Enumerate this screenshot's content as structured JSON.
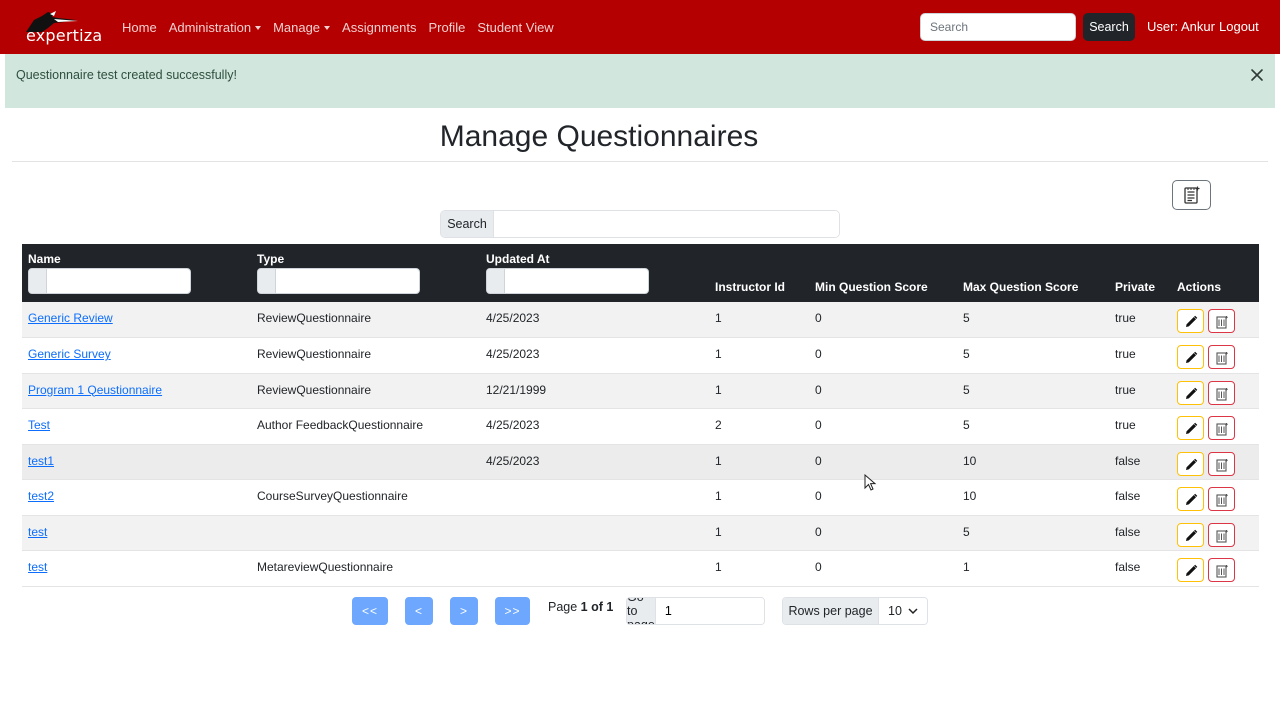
{
  "navbar": {
    "brand": "expertiza",
    "links": [
      {
        "label": "Home",
        "dropdown": false
      },
      {
        "label": "Administration",
        "dropdown": true
      },
      {
        "label": "Manage",
        "dropdown": true
      },
      {
        "label": "Assignments",
        "dropdown": false
      },
      {
        "label": "Profile",
        "dropdown": false
      },
      {
        "label": "Student View",
        "dropdown": false
      }
    ],
    "search_placeholder": "Search",
    "search_button": "Search",
    "user": "User: Ankur",
    "logout": "Logout",
    "color": "#b40000"
  },
  "alert": {
    "message": "Questionnaire test created successfully!",
    "color": "#d1e7dd"
  },
  "page": {
    "title": "Manage Questionnaires",
    "new_button_icon": "add-document-icon",
    "search_label": "Search",
    "search_value": ""
  },
  "table": {
    "headers": {
      "name": "Name",
      "type": "Type",
      "updated_at": "Updated At",
      "instructor_id": "Instructor Id",
      "min_score": "Min Question Score",
      "max_score": "Max Question Score",
      "private": "Private",
      "actions": "Actions"
    },
    "rows": [
      {
        "name": "Generic Review",
        "type": "ReviewQuestionnaire",
        "updated_at": "4/25/2023",
        "instructor_id": "1",
        "min_score": "0",
        "max_score": "5",
        "private": "true"
      },
      {
        "name": "Generic Survey",
        "type": "ReviewQuestionnaire",
        "updated_at": "4/25/2023",
        "instructor_id": "1",
        "min_score": "0",
        "max_score": "5",
        "private": "true"
      },
      {
        "name": "Program 1 Qeustionnaire",
        "type": "ReviewQuestionnaire",
        "updated_at": "12/21/1999",
        "instructor_id": "1",
        "min_score": "0",
        "max_score": "5",
        "private": "true"
      },
      {
        "name": "Test",
        "type": "Author FeedbackQuestionnaire",
        "updated_at": "4/25/2023",
        "instructor_id": "2",
        "min_score": "0",
        "max_score": "5",
        "private": "true"
      },
      {
        "name": "test1",
        "type": "",
        "updated_at": "4/25/2023",
        "instructor_id": "1",
        "min_score": "0",
        "max_score": "10",
        "private": "false"
      },
      {
        "name": "test2",
        "type": "CourseSurveyQuestionnaire",
        "updated_at": "",
        "instructor_id": "1",
        "min_score": "0",
        "max_score": "10",
        "private": "false"
      },
      {
        "name": "test",
        "type": "",
        "updated_at": "",
        "instructor_id": "1",
        "min_score": "0",
        "max_score": "5",
        "private": "false"
      },
      {
        "name": "test",
        "type": "MetareviewQuestionnaire",
        "updated_at": "",
        "instructor_id": "1",
        "min_score": "0",
        "max_score": "1",
        "private": "false"
      }
    ],
    "action_icons": [
      "edit-pencil-icon",
      "delete-icon"
    ]
  },
  "pagination": {
    "first": "<<",
    "prev": "<",
    "next": ">",
    "last": ">>",
    "page_prefix": "Page ",
    "page_current": "1 of 1",
    "goto_label": "Go to page",
    "goto_value": "1",
    "rows_label": "Rows per page",
    "rows_value": "10"
  }
}
